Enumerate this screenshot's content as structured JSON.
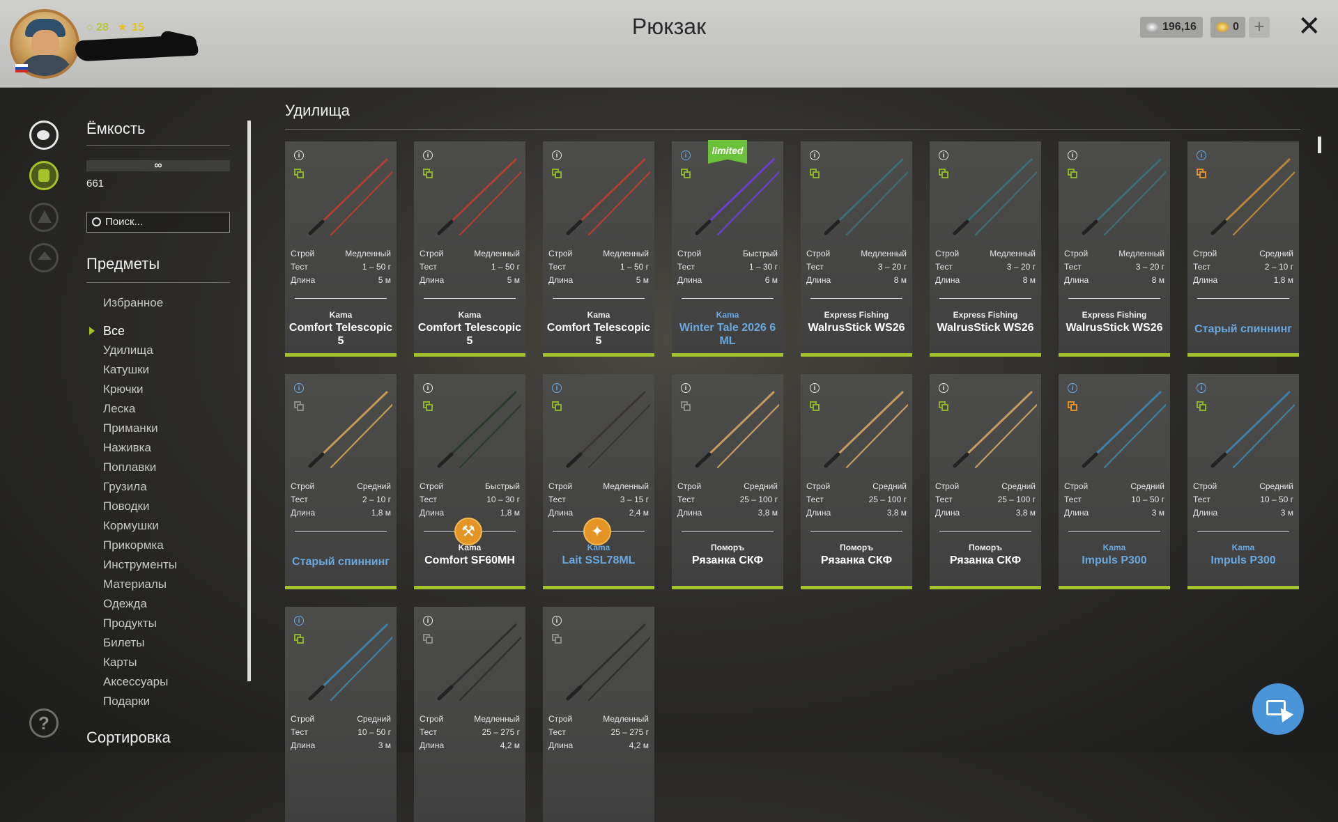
{
  "header": {
    "title": "Рюкзак",
    "level": "28",
    "stars": "15",
    "silver": "196,16",
    "gold": "0",
    "plus": "+",
    "close": "✕"
  },
  "sidebar": {
    "capacity_title": "Ёмкость",
    "capacity_value": "∞",
    "capacity_count": "661",
    "search_placeholder": "Поиск...",
    "items_title": "Предметы",
    "categories": [
      "Избранное",
      "Все",
      "Удилища",
      "Катушки",
      "Крючки",
      "Леска",
      "Приманки",
      "Наживка",
      "Поплавки",
      "Грузила",
      "Поводки",
      "Кормушки",
      "Прикормка",
      "Инструменты",
      "Материалы",
      "Одежда",
      "Продукты",
      "Билеты",
      "Карты",
      "Аксессуары",
      "Подарки"
    ],
    "active_category": "Все",
    "sort_title": "Сортировка",
    "help": "?"
  },
  "section": {
    "title": "Удилища"
  },
  "spec_labels": {
    "action": "Строй",
    "test": "Тест",
    "length": "Длина"
  },
  "rods": [
    {
      "brand": "Kama",
      "name": "Comfort Telescopic 5",
      "action": "Медленный",
      "test": "1 – 50 г",
      "length": "5 м",
      "color": "#b0402f",
      "info": "white",
      "copy": "green"
    },
    {
      "brand": "Kama",
      "name": "Comfort Telescopic 5",
      "action": "Медленный",
      "test": "1 – 50 г",
      "length": "5 м",
      "color": "#b0402f",
      "info": "white",
      "copy": "green"
    },
    {
      "brand": "Kama",
      "name": "Comfort Telescopic 5",
      "action": "Медленный",
      "test": "1 – 50 г",
      "length": "5 м",
      "color": "#b0402f",
      "info": "white",
      "copy": "green"
    },
    {
      "brand": "Kama",
      "name": "Winter Tale 2026 6 ML",
      "action": "Быстрый",
      "test": "1 – 30 г",
      "length": "6 м",
      "color": "#6a3fd0",
      "info": "blue",
      "copy": "green",
      "blue": true,
      "limited": "limited"
    },
    {
      "brand": "Express Fishing",
      "name": "WalrusStick WS26",
      "action": "Медленный",
      "test": "3 – 20 г",
      "length": "8 м",
      "color": "#3b6f74",
      "info": "white",
      "copy": "green"
    },
    {
      "brand": "Express Fishing",
      "name": "WalrusStick WS26",
      "action": "Медленный",
      "test": "3 – 20 г",
      "length": "8 м",
      "color": "#3b6f74",
      "info": "white",
      "copy": "green"
    },
    {
      "brand": "Express Fishing",
      "name": "WalrusStick WS26",
      "action": "Медленный",
      "test": "3 – 20 г",
      "length": "8 м",
      "color": "#3b6f74",
      "info": "white",
      "copy": "green"
    },
    {
      "brand": "",
      "name": "Старый спиннинг",
      "action": "Средний",
      "test": "2 – 10 г",
      "length": "1,8 м",
      "color": "#b9863a",
      "info": "blue",
      "copy": "orange",
      "blue": true
    },
    {
      "brand": "",
      "name": "Старый спиннинг",
      "action": "Средний",
      "test": "2 – 10 г",
      "length": "1,8 м",
      "color": "#c69a54",
      "info": "blue",
      "copy": "grey",
      "blue": true
    },
    {
      "brand": "Kama",
      "name": "Comfort SF60MH",
      "action": "Быстрый",
      "test": "10 – 30 г",
      "length": "1,8 м",
      "color": "#2a3a2a",
      "info": "white",
      "copy": "green",
      "badge": "⚒"
    },
    {
      "brand": "Kama",
      "name": "Lait SSL78ML",
      "action": "Медленный",
      "test": "3 – 15 г",
      "length": "2,4 м",
      "color": "#3a3432",
      "info": "blue",
      "copy": "green",
      "blue": true,
      "badge": "✦"
    },
    {
      "brand": "Поморъ",
      "name": "Рязанка СКФ",
      "action": "Средний",
      "test": "25 – 100 г",
      "length": "3,8 м",
      "color": "#c89b62",
      "info": "white",
      "copy": "grey"
    },
    {
      "brand": "Поморъ",
      "name": "Рязанка СКФ",
      "action": "Средний",
      "test": "25 – 100 г",
      "length": "3,8 м",
      "color": "#c89b62",
      "info": "white",
      "copy": "green"
    },
    {
      "brand": "Поморъ",
      "name": "Рязанка СКФ",
      "action": "Средний",
      "test": "25 – 100 г",
      "length": "3,8 м",
      "color": "#c89b62",
      "info": "white",
      "copy": "green"
    },
    {
      "brand": "Kama",
      "name": "Impuls P300",
      "action": "Средний",
      "test": "10 – 50 г",
      "length": "3 м",
      "color": "#3d7fa8",
      "info": "blue",
      "copy": "orange",
      "blue": true
    },
    {
      "brand": "Kama",
      "name": "Impuls P300",
      "action": "Средний",
      "test": "10 – 50 г",
      "length": "3 м",
      "color": "#3d7fa8",
      "info": "blue",
      "copy": "green",
      "blue": true
    },
    {
      "brand": "",
      "name": "",
      "action": "Средний",
      "test": "10 – 50 г",
      "length": "3 м",
      "color": "#3d7fa8",
      "info": "blue",
      "copy": "green"
    },
    {
      "brand": "",
      "name": "",
      "action": "Медленный",
      "test": "25 – 275 г",
      "length": "4,2 м",
      "color": "#2e2e2e",
      "info": "white",
      "copy": "grey"
    },
    {
      "brand": "",
      "name": "",
      "action": "Медленный",
      "test": "25 – 275 г",
      "length": "4,2 м",
      "color": "#2e2e2e",
      "info": "white",
      "copy": "grey"
    }
  ]
}
